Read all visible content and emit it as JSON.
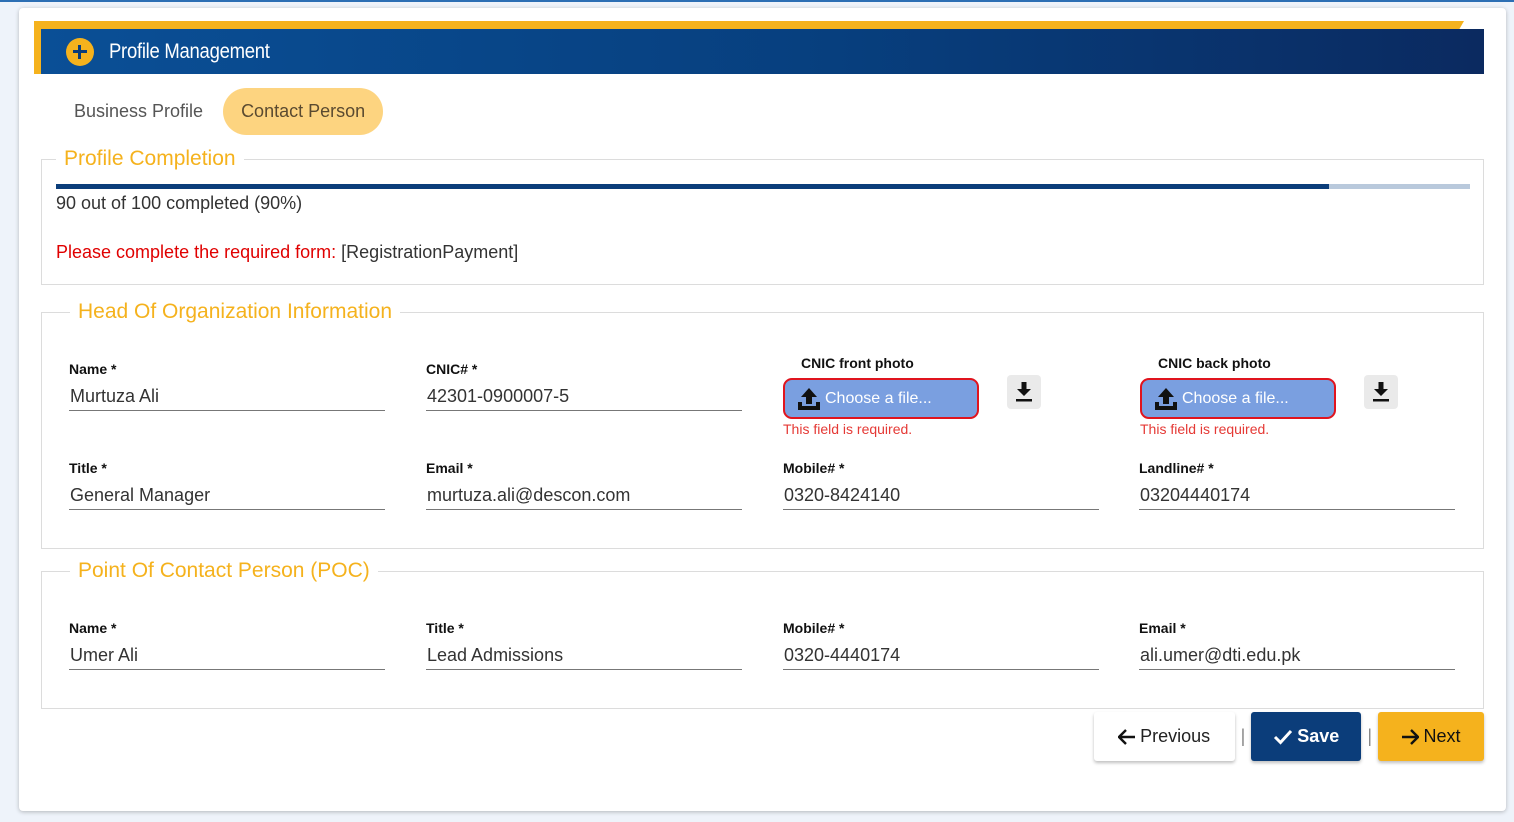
{
  "header": {
    "title": "Profile Management",
    "icon": "plus-circle-icon"
  },
  "tabs": [
    {
      "label": "Business Profile",
      "active": false
    },
    {
      "label": "Contact Person",
      "active": true
    }
  ],
  "completion": {
    "legend": "Profile Completion",
    "progress_percent": 90,
    "progress_text": "90 out of 100 completed (90%)",
    "warning_label": "Please complete the required form:",
    "warning_form": "[RegistrationPayment]"
  },
  "head_org": {
    "legend": "Head Of Organization Information",
    "name": {
      "label": "Name *",
      "value": "Murtuza Ali"
    },
    "cnic": {
      "label": "CNIC# *",
      "value": "42301-0900007-5"
    },
    "cnic_front": {
      "label": "CNIC front photo",
      "button": "Choose a file...",
      "error": "This field is required."
    },
    "cnic_back": {
      "label": "CNIC back photo",
      "button": "Choose a file...",
      "error": "This field is required."
    },
    "title": {
      "label": "Title *",
      "value": "General Manager"
    },
    "email": {
      "label": "Email *",
      "value": "murtuza.ali@descon.com"
    },
    "mobile": {
      "label": "Mobile# *",
      "value": "0320-8424140"
    },
    "landline": {
      "label": "Landline# *",
      "value": "03204440174"
    }
  },
  "poc": {
    "legend": "Point Of Contact Person (POC)",
    "name": {
      "label": "Name *",
      "value": "Umer Ali"
    },
    "title": {
      "label": "Title *",
      "value": "Lead Admissions"
    },
    "mobile": {
      "label": "Mobile# *",
      "value": "0320-4440174"
    },
    "email": {
      "label": "Email *",
      "value": "ali.umer@dti.edu.pk"
    }
  },
  "actions": {
    "previous": "Previous",
    "save": "Save",
    "next": "Next",
    "separator": "|"
  },
  "colors": {
    "accent": "#f5b21d",
    "primary": "#0b3d7a",
    "error": "#e00000"
  }
}
